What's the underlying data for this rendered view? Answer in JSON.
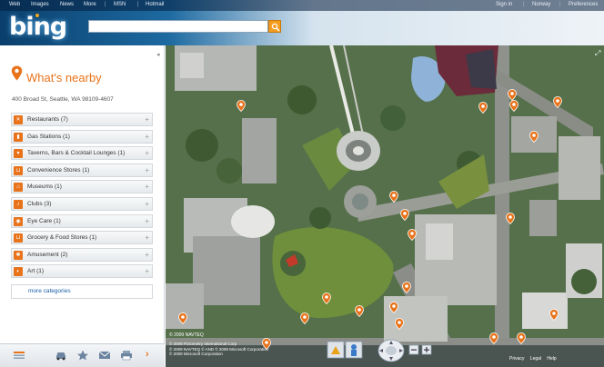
{
  "topnav": {
    "left": [
      "Web",
      "Images",
      "News",
      "More",
      "MSN",
      "Hotmail"
    ],
    "right": [
      "Sign in",
      "Norway",
      "Preferences"
    ]
  },
  "logo": "bing",
  "search": {
    "value": "",
    "placeholder": ""
  },
  "panel": {
    "title": "What's nearby",
    "address": "400 Broad St, Seattle, WA 98109-4607",
    "categories": [
      {
        "label": "Restaurants (7)",
        "icon": "fork-knife-icon"
      },
      {
        "label": "Gas Stations (1)",
        "icon": "fuel-pump-icon"
      },
      {
        "label": "Taverns, Bars & Cocktail Lounges (1)",
        "icon": "cocktail-icon"
      },
      {
        "label": "Convenience Stores (1)",
        "icon": "cart-icon"
      },
      {
        "label": "Museums (1)",
        "icon": "museum-icon"
      },
      {
        "label": "Clubs (3)",
        "icon": "music-note-icon"
      },
      {
        "label": "Eye Care (1)",
        "icon": "eye-icon"
      },
      {
        "label": "Grocery & Food Stores (1)",
        "icon": "grocery-cart-icon"
      },
      {
        "label": "Amusement (2)",
        "icon": "ferris-wheel-icon"
      },
      {
        "label": "Art (1)",
        "icon": "palette-icon"
      }
    ],
    "more": "more categories"
  },
  "map": {
    "logo_text": "© 2009 NAVTEQ",
    "copyright": [
      "© 2009 Pictometry International Corp",
      "© 2009 NAVTEQ  © AND © 2009 Microsoft Corporation",
      "© 2009 Microsoft Corporation"
    ],
    "footer": [
      "Privacy",
      "Legal",
      "Help"
    ]
  },
  "colors": {
    "accent": "#e8731a",
    "link": "#1a5fa8",
    "brand": "#0a3f6c",
    "search_button": "#f59d1f"
  }
}
